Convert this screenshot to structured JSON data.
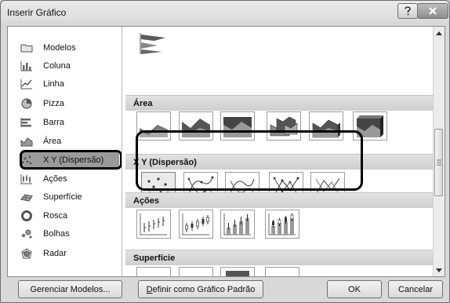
{
  "window": {
    "title": "Inserir Gráfico"
  },
  "sidebar": {
    "items": [
      {
        "label": "Modelos",
        "icon": "folder-icon"
      },
      {
        "label": "Coluna",
        "icon": "column-chart-icon"
      },
      {
        "label": "Linha",
        "icon": "line-chart-icon"
      },
      {
        "label": "Pizza",
        "icon": "pie-chart-icon"
      },
      {
        "label": "Barra",
        "icon": "bar-chart-icon"
      },
      {
        "label": "Área",
        "icon": "area-chart-icon"
      },
      {
        "label": "X Y (Dispersão)",
        "icon": "scatter-chart-icon",
        "selected": true
      },
      {
        "label": "Ações",
        "icon": "stock-chart-icon"
      },
      {
        "label": "Superfície",
        "icon": "surface-chart-icon"
      },
      {
        "label": "Rosca",
        "icon": "doughnut-chart-icon"
      },
      {
        "label": "Bolhas",
        "icon": "bubble-chart-icon"
      },
      {
        "label": "Radar",
        "icon": "radar-chart-icon"
      }
    ]
  },
  "gallery": {
    "sections": {
      "area": "Área",
      "scatter": "X Y (Dispersão)",
      "stock": "Ações",
      "surface": "Superfície"
    }
  },
  "footer": {
    "manage_templates": "Gerenciar Modelos...",
    "set_default_prefix": "D",
    "set_default_rest": "efinir como Gráfico Padrão",
    "ok": "OK",
    "cancel": "Cancelar"
  }
}
